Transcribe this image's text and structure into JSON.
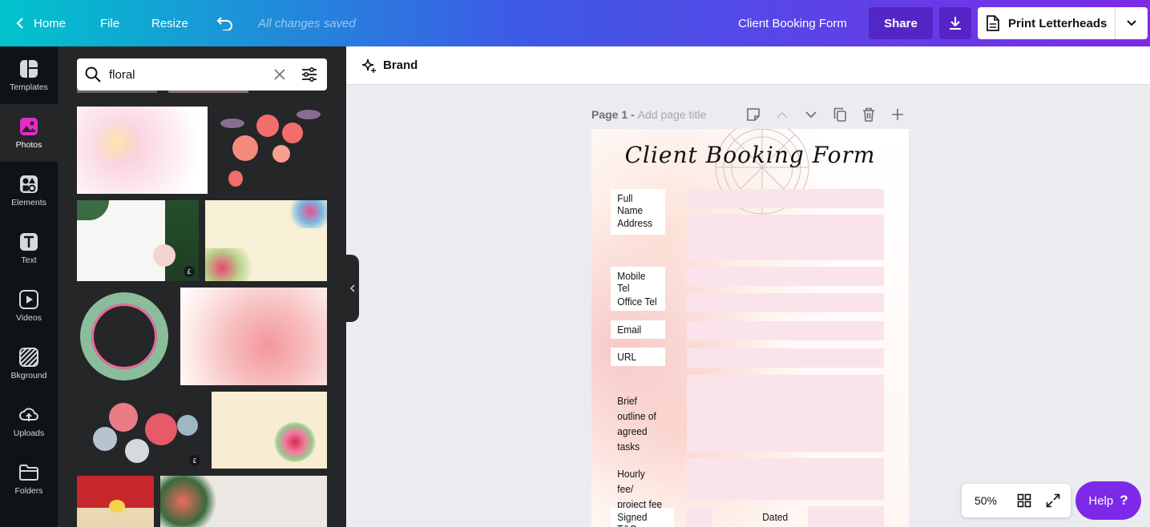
{
  "topbar": {
    "home": "Home",
    "file": "File",
    "resize": "Resize",
    "saved_status": "All changes saved",
    "doc_title": "Client Booking Form",
    "share": "Share",
    "print": "Print Letterheads"
  },
  "rail": [
    {
      "label": "Templates",
      "icon": "templates-icon"
    },
    {
      "label": "Photos",
      "icon": "photos-icon"
    },
    {
      "label": "Elements",
      "icon": "elements-icon"
    },
    {
      "label": "Text",
      "icon": "text-icon"
    },
    {
      "label": "Videos",
      "icon": "videos-icon"
    },
    {
      "label": "Bkground",
      "icon": "background-icon"
    },
    {
      "label": "Uploads",
      "icon": "uploads-icon"
    },
    {
      "label": "Folders",
      "icon": "folders-icon"
    }
  ],
  "search": {
    "value": "floral"
  },
  "thumb_badge": "£",
  "brand": "Brand",
  "page": {
    "label": "Page 1 -",
    "title_placeholder": "Add page title"
  },
  "form": {
    "title": "Client Booking Form",
    "fields": {
      "full_name": "Full Name",
      "address": "Address",
      "mobile": "Mobile Tel",
      "office": "Office Tel",
      "email": "Email",
      "url": "URL",
      "brief": "Brief outline of agreed tasks",
      "fee": "Hourly fee/ project fee",
      "signed": "Signed T&Cs",
      "dated": "Dated"
    }
  },
  "zoom": "50%",
  "help": "Help",
  "help_mark": "?",
  "colors": {
    "accent": "#7d2ae8",
    "gradient_start": "#00c4cc",
    "panel": "#252627",
    "rail": "#0e1318",
    "field": "#fae3ea"
  }
}
